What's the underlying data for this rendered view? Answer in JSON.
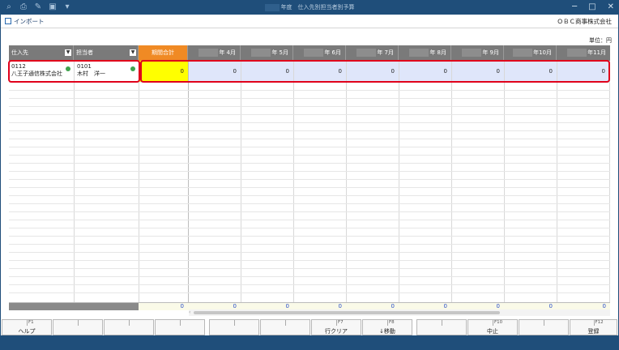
{
  "titlebar": {
    "title_text": "年度　仕入先別担当者別予算",
    "icons": [
      "search-plus-icon",
      "print-icon",
      "tools-icon",
      "save-icon",
      "dropdown-icon"
    ],
    "win_min": "─",
    "win_max": "□",
    "win_close": "✕"
  },
  "toolbar": {
    "import_label": "インポート",
    "company": "ＯＢＣ商事株式会社"
  },
  "unit_label": "単位：円",
  "columns": {
    "supplier": "仕入先",
    "person": "担当者",
    "total": "期間合計",
    "months": [
      "年 4月",
      "年 5月",
      "年 6月",
      "年 7月",
      "年 8月",
      "年 9月",
      "年10月",
      "年11月"
    ]
  },
  "row": {
    "supplier_code": "0112",
    "supplier_name": "八王子通信株式会社",
    "person_code": "0101",
    "person_name": "木村　洋一",
    "total": "0",
    "months": [
      "0",
      "0",
      "0",
      "0",
      "0",
      "0",
      "0",
      "0"
    ]
  },
  "footer_totals": {
    "total": "0",
    "months": [
      "0",
      "0",
      "0",
      "0",
      "0",
      "0",
      "0",
      "0"
    ]
  },
  "fkeys": [
    {
      "key": "F1",
      "label": "ヘルプ"
    },
    {
      "key": "",
      "label": ""
    },
    {
      "key": "",
      "label": ""
    },
    {
      "key": "",
      "label": ""
    },
    {
      "key": "",
      "label": ""
    },
    {
      "key": "",
      "label": ""
    },
    {
      "key": "F7",
      "label": "行クリア"
    },
    {
      "key": "F8",
      "label": "↓移動"
    },
    {
      "key": "",
      "label": ""
    },
    {
      "key": "F10",
      "label": "中止"
    },
    {
      "key": "",
      "label": ""
    },
    {
      "key": "F12",
      "label": "登録"
    }
  ],
  "colors": {
    "accent": "#f08a24",
    "highlight": "#ffff00",
    "selection_border": "#e0001b",
    "title_bar": "#1f4e7a"
  }
}
